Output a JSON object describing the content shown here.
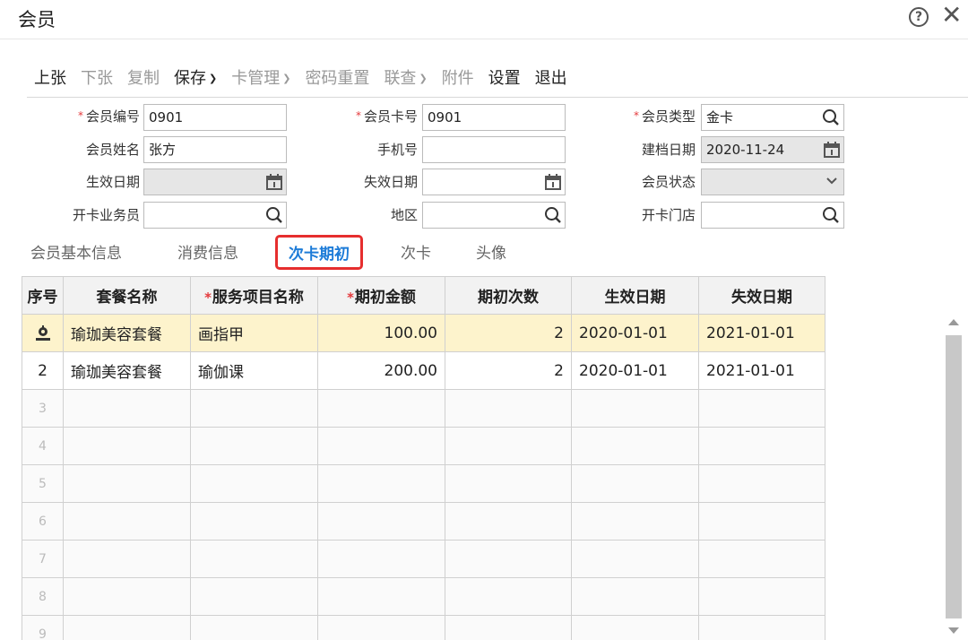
{
  "window": {
    "title": "会员",
    "help_glyph": "?",
    "close_glyph": "✕"
  },
  "toolbar": {
    "prev": "上张",
    "next": "下张",
    "copy": "复制",
    "save": "保存",
    "card_mgmt": "卡管理",
    "pwd_reset": "密码重置",
    "linked_query": "联查",
    "attachment": "附件",
    "settings": "设置",
    "exit": "退出"
  },
  "form": {
    "member_no": {
      "label": "会员编号",
      "value": "0901",
      "required": true
    },
    "member_card_no": {
      "label": "会员卡号",
      "value": "0901",
      "required": true
    },
    "member_type": {
      "label": "会员类型",
      "value": "金卡",
      "required": true
    },
    "member_name": {
      "label": "会员姓名",
      "value": "张方"
    },
    "phone": {
      "label": "手机号",
      "value": ""
    },
    "created_date": {
      "label": "建档日期",
      "value": "2020-11-24"
    },
    "effective_date": {
      "label": "生效日期",
      "value": ""
    },
    "expiry_date": {
      "label": "失效日期",
      "value": ""
    },
    "member_status": {
      "label": "会员状态",
      "value": ""
    },
    "card_clerk": {
      "label": "开卡业务员",
      "value": ""
    },
    "region": {
      "label": "地区",
      "value": ""
    },
    "card_store": {
      "label": "开卡门店",
      "value": ""
    }
  },
  "tabs": [
    {
      "label": "会员基本信息",
      "active": false
    },
    {
      "label": "消费信息",
      "active": false
    },
    {
      "label": "次卡期初",
      "active": true
    },
    {
      "label": "次卡",
      "active": false
    },
    {
      "label": "头像",
      "active": false
    }
  ],
  "grid": {
    "headers": [
      "序号",
      "套餐名称",
      "服务项目名称",
      "期初金额",
      "期初次数",
      "生效日期",
      "失效日期"
    ],
    "rows": [
      {
        "seq": "",
        "package": "瑜珈美容套餐",
        "service": "画指甲",
        "amount": "100.00",
        "count": "2",
        "start": "2020-01-01",
        "end": "2021-01-01"
      },
      {
        "seq": "2",
        "package": "瑜珈美容套餐",
        "service": "瑜伽课",
        "amount": "200.00",
        "count": "2",
        "start": "2020-01-01",
        "end": "2021-01-01"
      }
    ],
    "empty_rows": [
      "3",
      "4",
      "5",
      "6",
      "7",
      "8",
      "9"
    ]
  },
  "colors": {
    "accent": "#1e7cd8",
    "required": "#e4393c",
    "highlight_border": "#e62e2e",
    "selected_row": "#fdf3cc"
  },
  "icons": [
    "help-icon",
    "close-icon",
    "search-icon",
    "calendar-icon",
    "chevron-down-icon",
    "row-settings-icon"
  ]
}
